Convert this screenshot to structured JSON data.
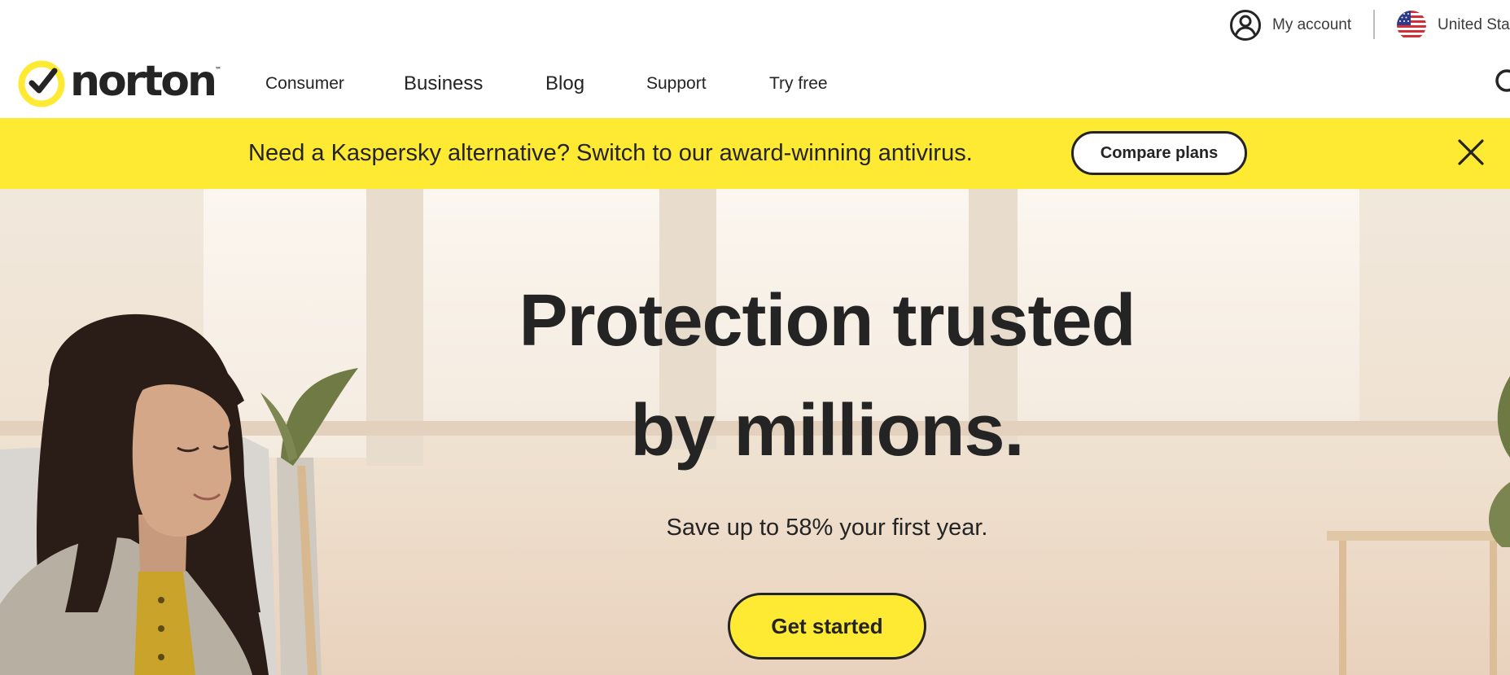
{
  "utility": {
    "account_label": "My account",
    "country_label": "United States",
    "account_icon": "user-circle-icon",
    "flag_icon": "us-flag-icon"
  },
  "nav": {
    "logo_text": "norton",
    "logo_tm": "™",
    "items": [
      {
        "label": "Consumer"
      },
      {
        "label": "Business"
      },
      {
        "label": "Blog"
      },
      {
        "label": "Support"
      },
      {
        "label": "Try free"
      }
    ],
    "search_icon": "search-icon"
  },
  "promo": {
    "text": "Need a Kaspersky alternative? Switch to our award-winning antivirus.",
    "button_label": "Compare plans",
    "close_icon": "close-icon"
  },
  "hero": {
    "title_line1": "Protection trusted",
    "title_line2": "by millions.",
    "subtitle": "Save up to 58% your first year.",
    "cta_label": "Get started"
  },
  "colors": {
    "brand_yellow": "#fee933",
    "text_dark": "#242424",
    "white": "#ffffff"
  }
}
